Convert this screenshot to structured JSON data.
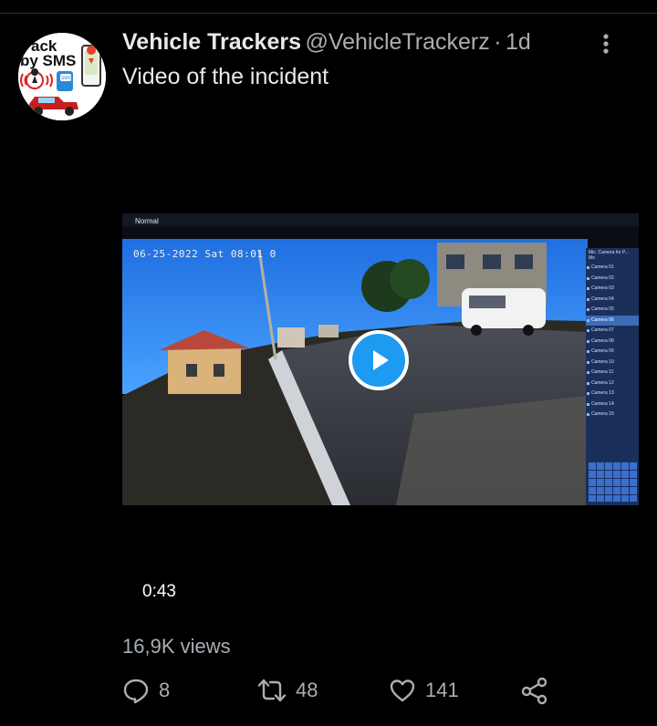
{
  "tweet": {
    "display_name": "Vehicle Trackers",
    "handle": "@VehicleTrackerz",
    "separator": "·",
    "timestamp": "1d",
    "text": "Video of the incident",
    "avatar": {
      "line1": "ack",
      "line2": "by SMS",
      "badge": "SMS"
    }
  },
  "video": {
    "duration": "0:43",
    "osd_date": "06-25-2022 Sat 08:01 0",
    "osd_mode": "Normal",
    "panel_header": "Mic. Camera for P... Mo",
    "cameras": [
      "Camera 01",
      "Camera 02",
      "Camera 03",
      "Camera 04",
      "Camera 05",
      "Camera 06",
      "Camera 07",
      "Camera 08",
      "Camera 09",
      "Camera 10",
      "Camera 11",
      "Camera 12",
      "Camera 13",
      "Camera 14",
      "Camera 15"
    ],
    "selected_camera_index": 5
  },
  "stats": {
    "views": "16,9K views",
    "replies": "8",
    "retweets": "48",
    "likes": "141"
  },
  "colors": {
    "background": "#000000",
    "primary_text": "#e7e9ea",
    "secondary_text": "#a9aeb3",
    "accent": "#1d9bf0"
  }
}
